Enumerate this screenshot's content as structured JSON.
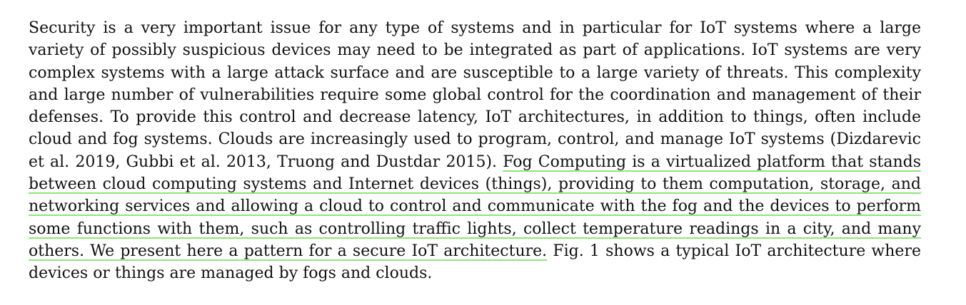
{
  "document": {
    "paragraph": {
      "before_highlight": "Security is a very important issue for any type of systems and in particular for IoT systems where a large variety of possibly suspicious devices may need to be integrated as part of applications. IoT systems are very complex systems with a large attack surface and are susceptible to a large variety of threats. This complexity and large number of vulnerabilities require some global control for the coordination and management of their defenses. To provide this control and decrease latency, IoT architectures, in addition to things, often include cloud and fog systems. Clouds are increasingly used to program, control, and manage IoT systems (Dizdarevic et al. 2019, Gubbi et al. 2013, Truong and Dustdar 2015). ",
      "highlighted": "Fog Computing is a virtualized platform that stands between cloud computing systems and Internet devices (things), providing to them computation, storage, and networking services and allowing a cloud to control and communicate with the fog and the devices to perform some functions with them, such as controlling traffic lights, collect temperature readings in a city, and many others. We present here a pattern for a secure IoT architecture.",
      "after_highlight": " Fig. 1 shows a typical IoT architecture where devices or things are managed by fogs and clouds."
    },
    "highlight_color": "#8be67a"
  }
}
